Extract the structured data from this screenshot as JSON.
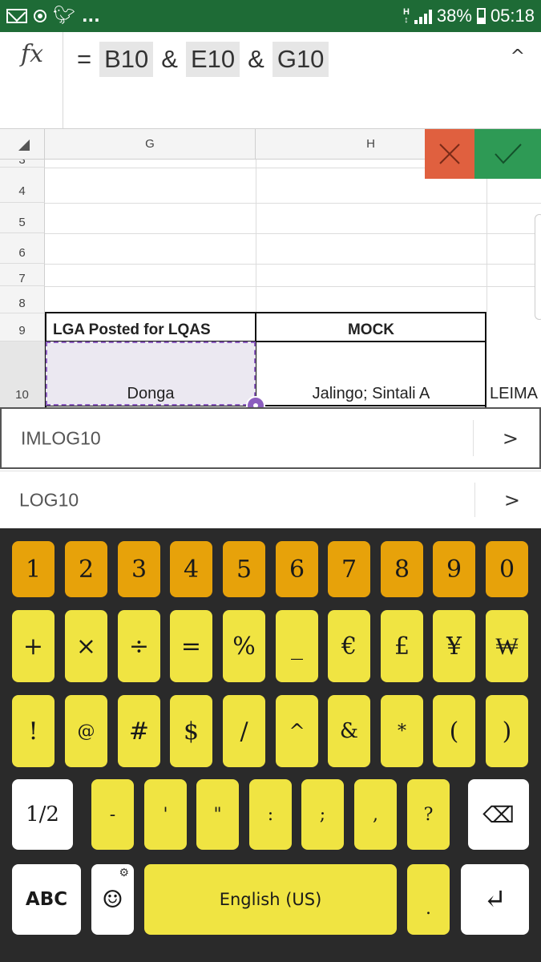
{
  "status_bar": {
    "overflow": "...",
    "network": "H",
    "battery_percent": "38%",
    "time": "05:18"
  },
  "formula_bar": {
    "fx_label": "fx",
    "tokens": [
      "=",
      "B10",
      "&",
      "E10",
      "&",
      "G10"
    ],
    "collapse_icon": "^"
  },
  "grid": {
    "columns": [
      "G",
      "H"
    ],
    "row_labels": [
      "3",
      "4",
      "5",
      "6",
      "7",
      "8",
      "9",
      "10"
    ],
    "cells": {
      "G9": "LGA Posted for LQAS",
      "H9": "MOCK",
      "G10": "Donga",
      "H10": "Jalingo; Sintali A",
      "I10": "LEIMA"
    },
    "cancel_icon": "×",
    "confirm_icon": "✓",
    "selected_cell": "G10"
  },
  "suggestions": [
    {
      "label": "IMLOG10",
      "chevron": ">"
    },
    {
      "label": "LOG10",
      "chevron": ">"
    }
  ],
  "keyboard": {
    "numbers": [
      "1",
      "2",
      "3",
      "4",
      "5",
      "6",
      "7",
      "8",
      "9",
      "0"
    ],
    "row2": [
      "+",
      "×",
      "÷",
      "=",
      "%",
      "_",
      "€",
      "£",
      "¥",
      "₩"
    ],
    "row3": [
      "!",
      "@",
      "#",
      "$",
      "/",
      "^",
      "&",
      "*",
      "(",
      ")"
    ],
    "row4_toggle": "1/2",
    "row4": [
      "-",
      "'",
      "\"",
      ":",
      ";",
      ",",
      "?"
    ],
    "backspace_icon": "⌫",
    "abc_label": "ABC",
    "emoji_icon": "☺",
    "settings_icon": "⚙",
    "space_label": "English (US)",
    "period": ".",
    "enter_icon": "↵"
  },
  "colors": {
    "status_bar": "#1e6b36",
    "number_keys": "#e7a20a",
    "symbol_keys": "#f0e442",
    "cancel": "#e0603f",
    "confirm": "#2e9a55",
    "selection": "#8c5ebf"
  }
}
